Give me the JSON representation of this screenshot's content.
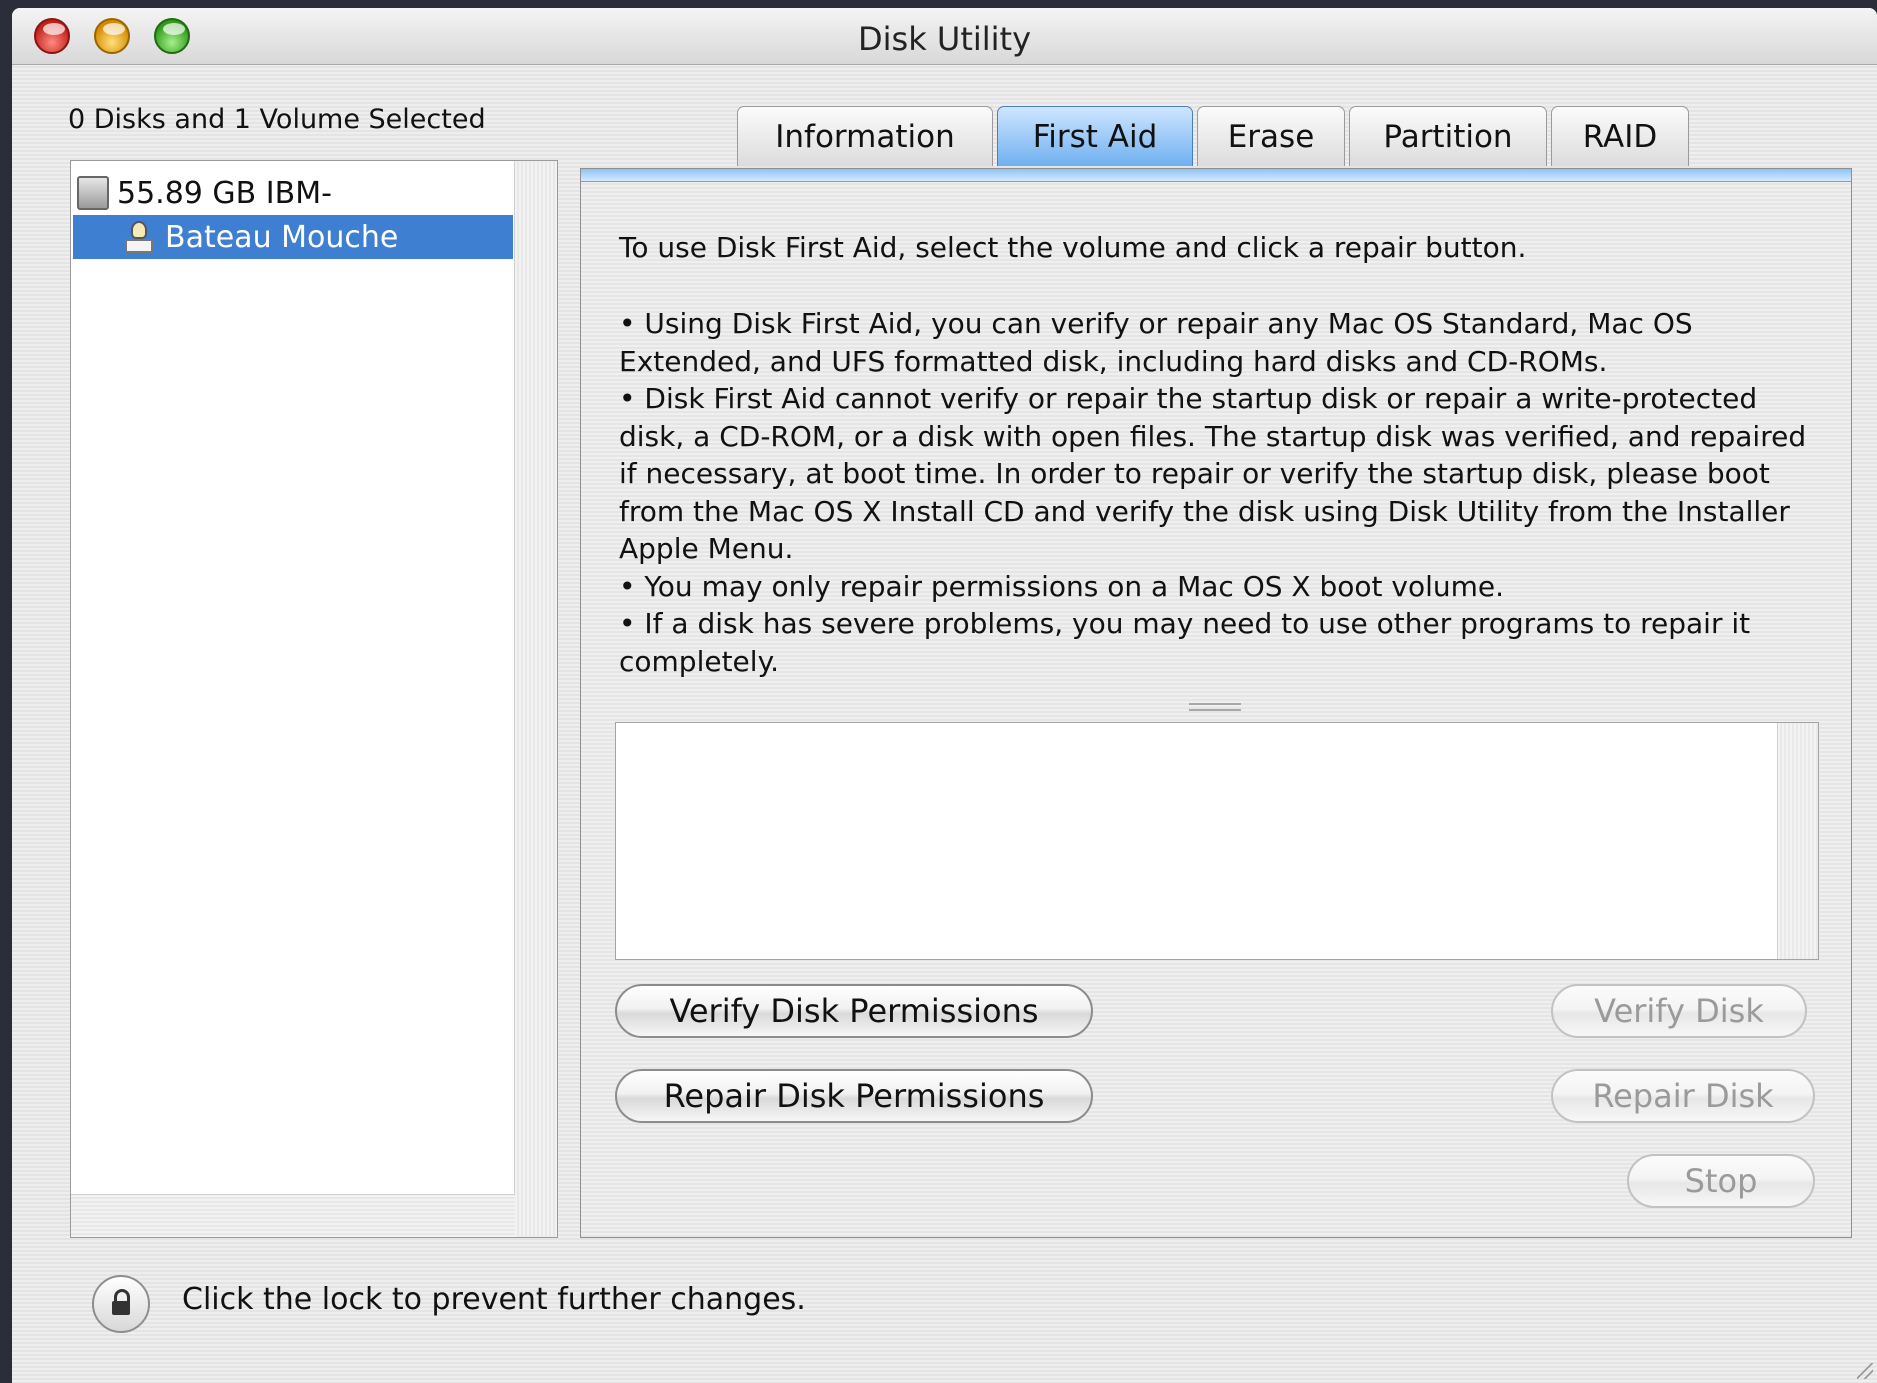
{
  "window": {
    "title": "Disk Utility"
  },
  "sidebar": {
    "summary": "0 Disks and 1 Volume Selected",
    "items": [
      {
        "label": "55.89 GB IBM-",
        "icon": "hard-disk-icon",
        "selected": false
      },
      {
        "label": "Bateau Mouche",
        "icon": "volume-icon",
        "selected": true
      }
    ],
    "selection_color": "#3e7fd1"
  },
  "tabs": [
    {
      "label": "Information",
      "active": false
    },
    {
      "label": "First Aid",
      "active": true
    },
    {
      "label": "Erase",
      "active": false
    },
    {
      "label": "Partition",
      "active": false
    },
    {
      "label": "RAID",
      "active": false
    }
  ],
  "first_aid": {
    "intro": "To use Disk First Aid, select the volume and click a repair button.",
    "bullets": [
      "• Using Disk First Aid, you can verify or repair any Mac OS Standard, Mac OS Extended, and UFS formatted disk, including hard disks and CD-ROMs.",
      "• Disk First Aid cannot verify or repair the startup disk or repair a write-protected disk, a CD-ROM, or a disk with open files.  The startup disk was verified, and repaired if necessary, at boot time.  In order to repair or verify the startup disk, please boot from the Mac OS X Install CD and verify the disk using Disk Utility from the Installer Apple Menu.",
      "• You may only repair permissions on a Mac OS X boot volume.",
      "• If a disk has severe problems, you may need to use other programs to repair it completely."
    ],
    "buttons": {
      "verify_permissions": "Verify Disk Permissions",
      "repair_permissions": "Repair Disk Permissions",
      "verify_disk": "Verify Disk",
      "repair_disk": "Repair Disk",
      "stop": "Stop"
    }
  },
  "footer": {
    "lock_text": "Click the lock to prevent further changes."
  }
}
